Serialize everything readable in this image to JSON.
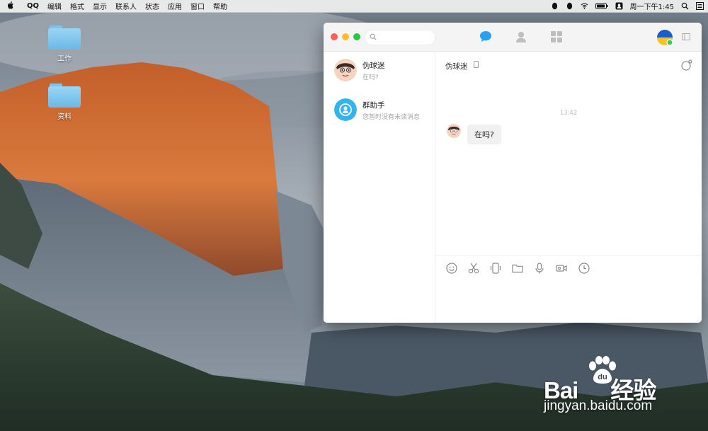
{
  "menubar": {
    "app_name": "QQ",
    "items": [
      "编辑",
      "格式",
      "显示",
      "联系人",
      "状态",
      "应用",
      "窗口",
      "帮助"
    ],
    "clock": "周一下午1:45"
  },
  "desktop": {
    "folders": [
      {
        "label": "工作"
      },
      {
        "label": "资料"
      }
    ]
  },
  "qq": {
    "search": {
      "placeholder": "",
      "value": ""
    },
    "conversations": [
      {
        "name": "伪球迷",
        "preview": "在吗?"
      },
      {
        "name": "群助手",
        "preview": "您暂时没有未读消息"
      }
    ],
    "chat": {
      "title": "伪球迷",
      "timestamp": "13:42",
      "message": "在吗?"
    },
    "colors": {
      "accent": "#2aa0f0",
      "close": "#fc5f57",
      "minimize": "#fdbc2e",
      "maximize": "#28c840"
    }
  },
  "watermark": {
    "brand_left": "Bai",
    "brand_mid": "du",
    "brand_right": "经验",
    "url": "jingyan.baidu.com"
  }
}
